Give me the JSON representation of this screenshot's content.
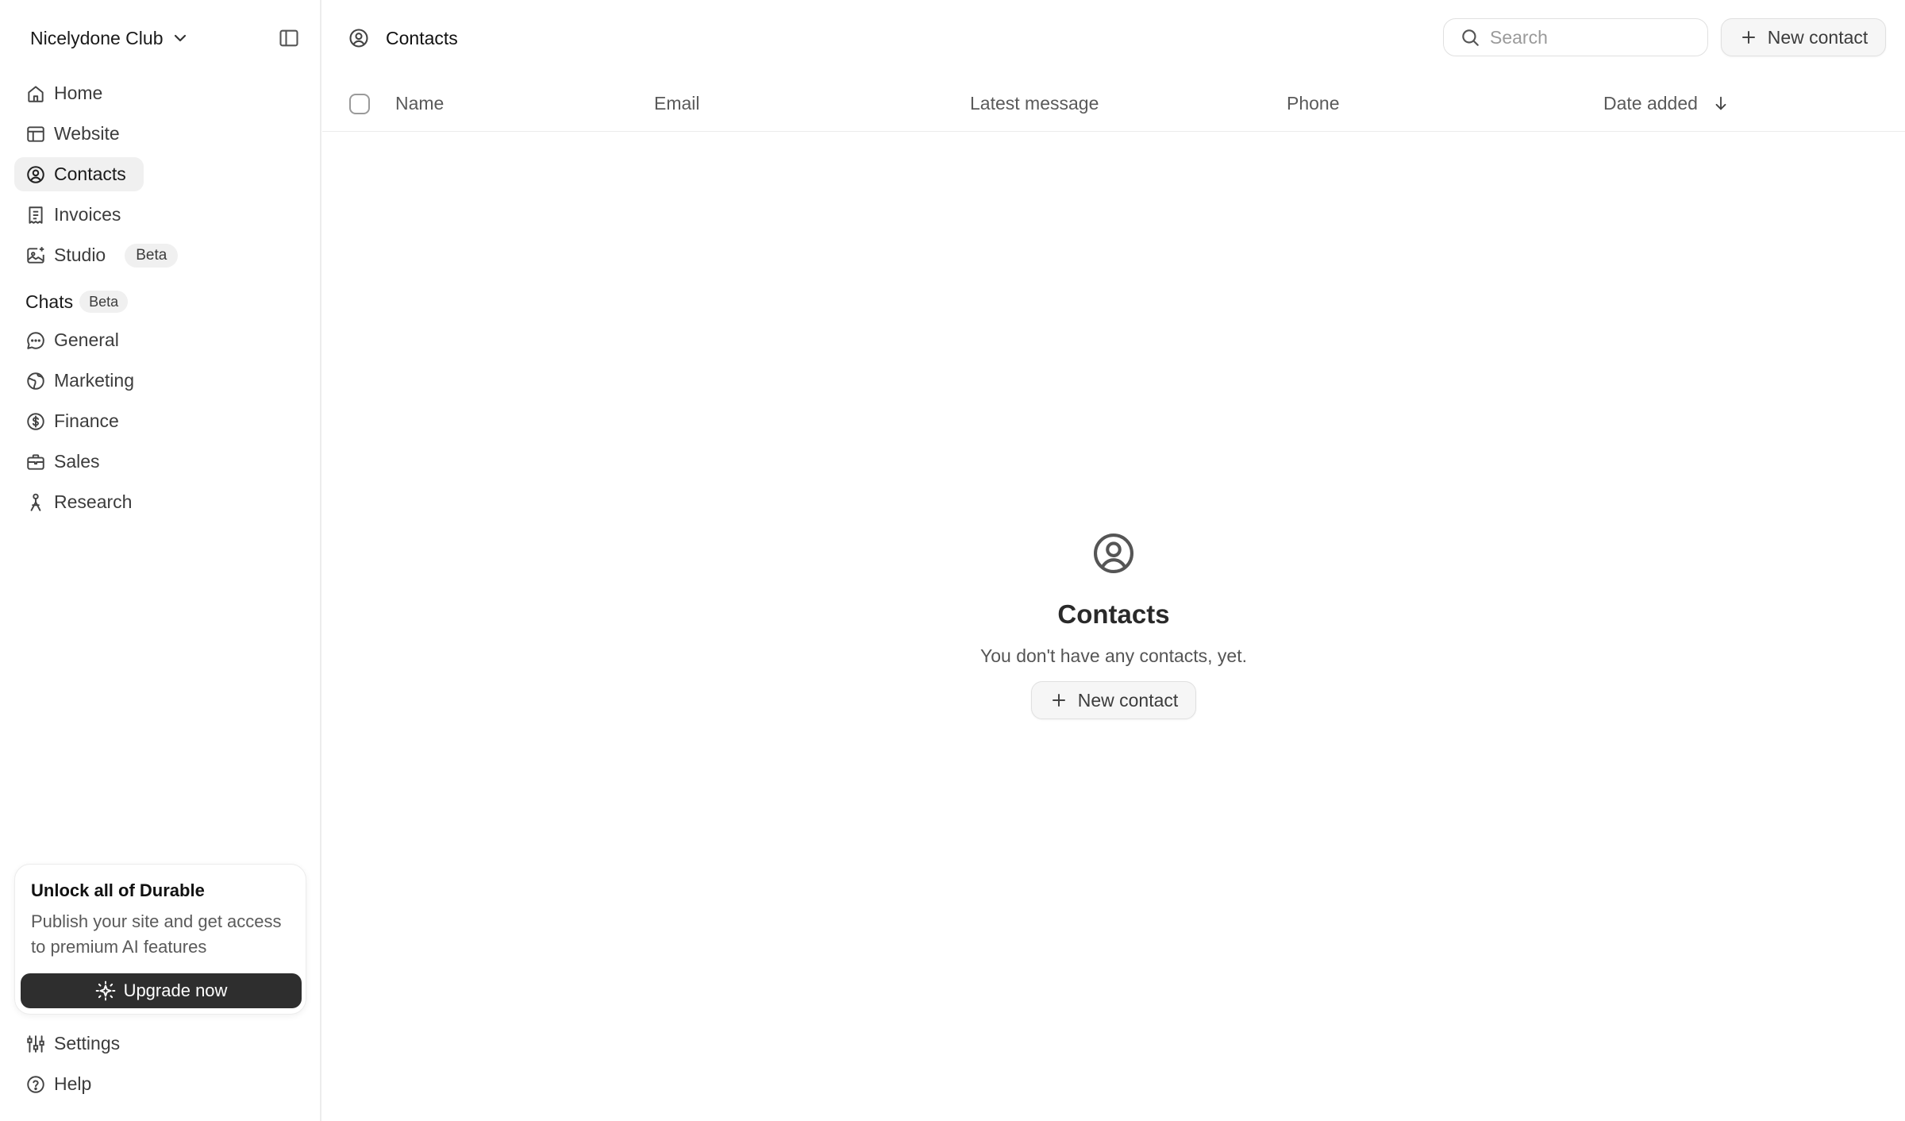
{
  "sidebar": {
    "workspace": "Nicelydone Club",
    "nav": [
      {
        "label": "Home",
        "icon": "home-icon"
      },
      {
        "label": "Website",
        "icon": "layout-icon"
      },
      {
        "label": "Contacts",
        "icon": "user-circle-icon",
        "active": true
      },
      {
        "label": "Invoices",
        "icon": "receipt-icon"
      },
      {
        "label": "Studio",
        "icon": "image-sparkle-icon",
        "badge": "Beta"
      }
    ],
    "chats": {
      "label": "Chats",
      "badge": "Beta",
      "items": [
        {
          "label": "General",
          "icon": "chat-bubble-icon"
        },
        {
          "label": "Marketing",
          "icon": "globe-icon"
        },
        {
          "label": "Finance",
          "icon": "dollar-circle-icon"
        },
        {
          "label": "Sales",
          "icon": "briefcase-icon"
        },
        {
          "label": "Research",
          "icon": "person-pin-icon"
        }
      ]
    },
    "upgrade": {
      "title": "Unlock all of Durable",
      "text": "Publish your site and get access to premium AI features",
      "button": "Upgrade now"
    },
    "footer": [
      {
        "label": "Settings",
        "icon": "sliders-icon"
      },
      {
        "label": "Help",
        "icon": "help-circle-icon"
      }
    ]
  },
  "header": {
    "title": "Contacts",
    "search_placeholder": "Search",
    "new_button": "New contact"
  },
  "table": {
    "columns": [
      "Name",
      "Email",
      "Latest message",
      "Phone",
      "Date added"
    ],
    "sort_column": "Date added",
    "sort_direction": "descending"
  },
  "empty_state": {
    "title": "Contacts",
    "text": "You don't have any contacts, yet.",
    "button": "New contact"
  },
  "colors": {
    "active_bg": "#f0f0f0",
    "upgrade_button_bg": "#2e2e2e",
    "border": "#ececec"
  }
}
